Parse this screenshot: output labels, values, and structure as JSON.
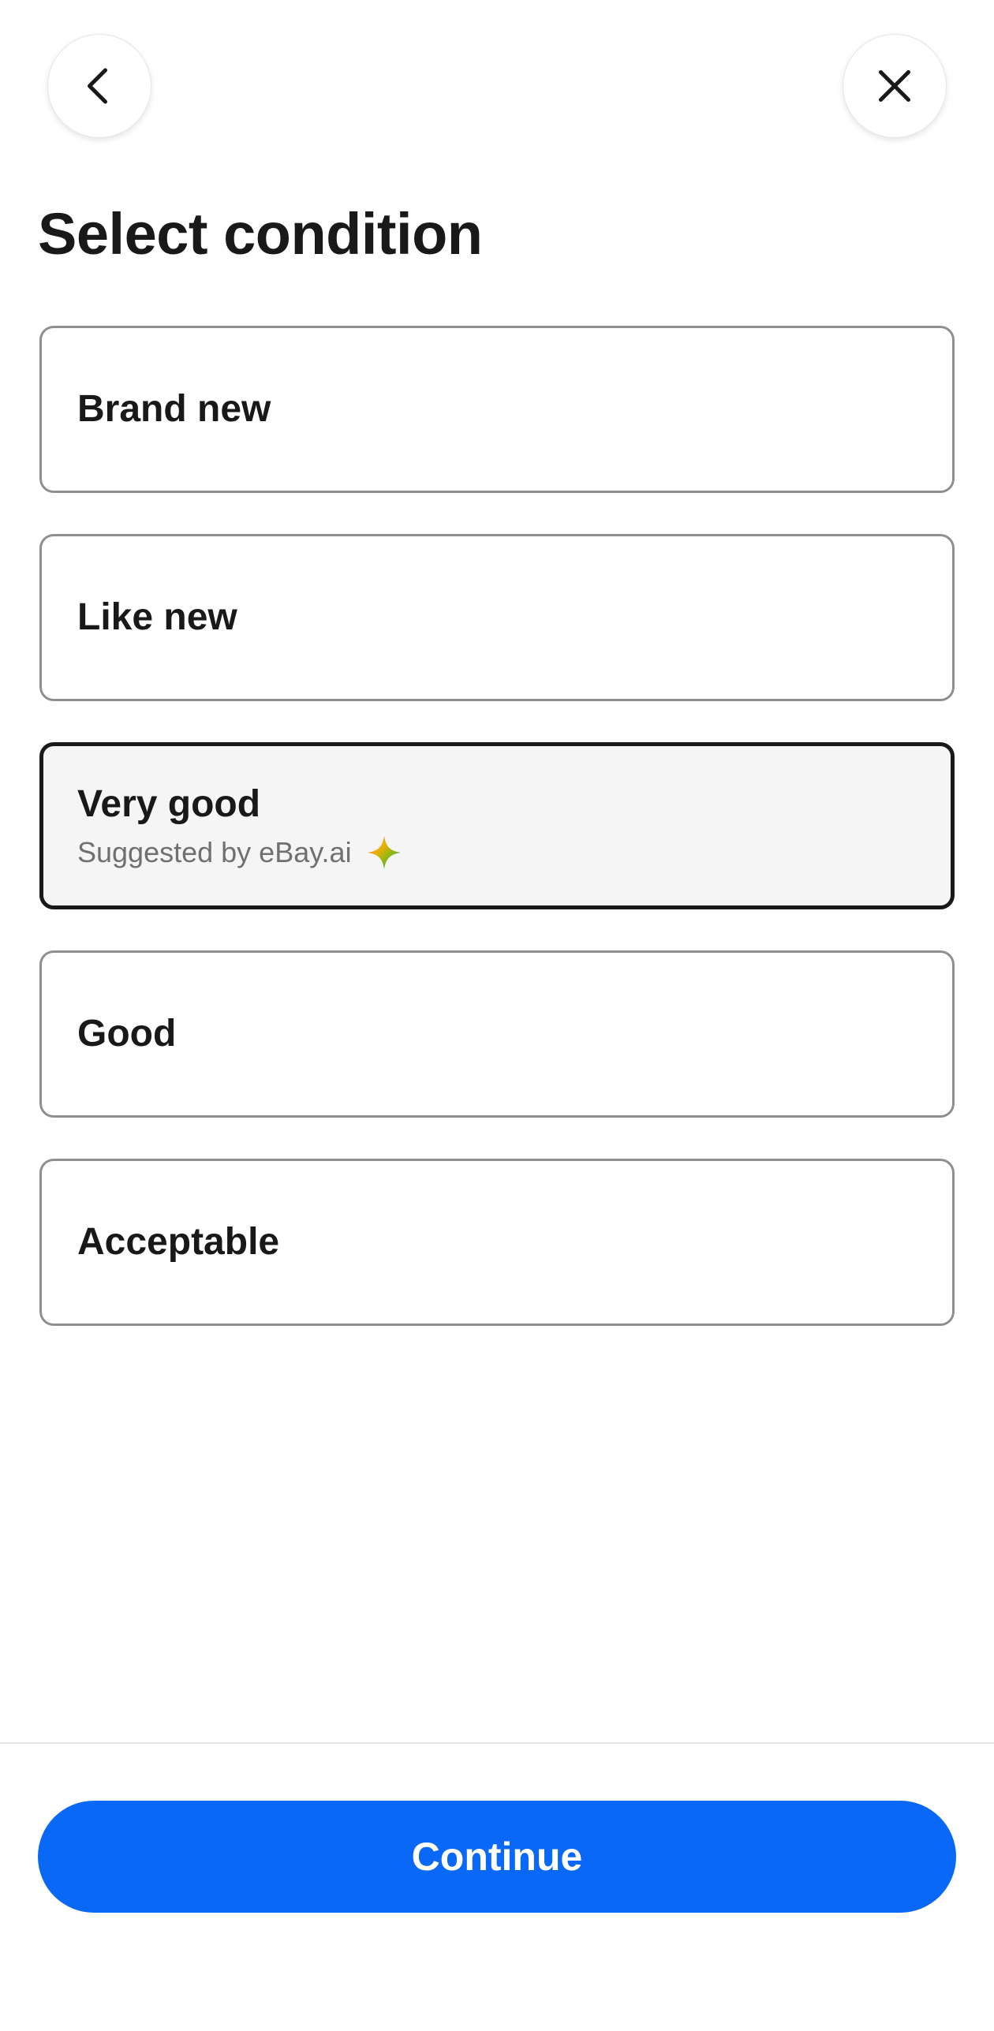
{
  "header": {
    "back_icon": "chevron-left-icon",
    "close_icon": "close-icon"
  },
  "page": {
    "title": "Select condition"
  },
  "options": [
    {
      "label": "Brand new"
    },
    {
      "label": "Like new"
    },
    {
      "label": "Very good",
      "subtitle": "Suggested by eBay.ai",
      "icon": "sparkle-icon",
      "selected": true
    },
    {
      "label": "Good"
    },
    {
      "label": "Acceptable"
    }
  ],
  "footer": {
    "continue_label": "Continue"
  },
  "colors": {
    "accent": "#0968f6",
    "text_primary": "#191919",
    "text_secondary": "#707070",
    "border": "#8f8f8f",
    "selected_bg": "#f5f5f5"
  }
}
